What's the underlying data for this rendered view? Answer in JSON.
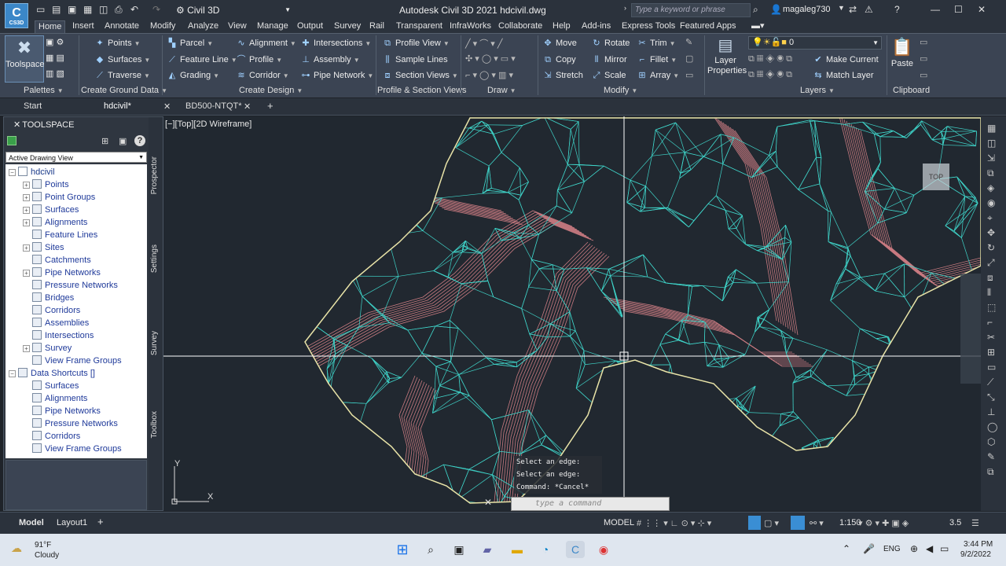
{
  "titlebar": {
    "logo": "C",
    "logo_sub": "CS3D",
    "workspace": "Civil 3D",
    "title": "Autodesk Civil 3D 2021   hdcivil.dwg",
    "search_placeholder": "Type a keyword or phrase",
    "user": "magaleg730"
  },
  "ribbon_tabs": [
    "Home",
    "Insert",
    "Annotate",
    "Modify",
    "Analyze",
    "View",
    "Manage",
    "Output",
    "Survey",
    "Rail",
    "Transparent",
    "InfraWorks",
    "Collaborate",
    "Help",
    "Add-ins",
    "Express Tools",
    "Featured Apps"
  ],
  "ribbon": {
    "toolspace": "Toolspace",
    "palettes": "Palettes",
    "ground": [
      "Points",
      "Surfaces",
      "Traverse"
    ],
    "ground_title": "Create Ground Data",
    "design_col1": [
      "Parcel",
      "Feature Line",
      "Grading"
    ],
    "design_col2": [
      "Alignment",
      "Profile",
      "Corridor"
    ],
    "design_col3": [
      "Intersections",
      "Assembly",
      "Pipe Network"
    ],
    "design_title": "Create Design",
    "profile": [
      "Profile View",
      "Sample Lines",
      "Section Views"
    ],
    "profile_title": "Profile & Section Views",
    "draw_title": "Draw",
    "modify_col1": [
      "Move",
      "Copy",
      "Stretch"
    ],
    "modify_col2": [
      "Rotate",
      "Mirror",
      "Scale"
    ],
    "modify_col3": [
      "Trim",
      "Fillet",
      "Array"
    ],
    "modify_title": "Modify",
    "layer_props": "Layer Properties",
    "layer_value": "0",
    "layer_actions": [
      "Make Current",
      "Match Layer"
    ],
    "layers_title": "Layers",
    "paste": "Paste",
    "clipboard_title": "Clipboard"
  },
  "doc_tabs": [
    "Start",
    "hdcivil*",
    "BD500-NTQT*"
  ],
  "toolspace": {
    "header": "TOOLSPACE",
    "view": "Active Drawing View",
    "side_tabs": [
      "Prospector",
      "Settings",
      "Survey",
      "Toolbox"
    ],
    "tree": [
      "hdcivil",
      "Points",
      "Point Groups",
      "Surfaces",
      "Alignments",
      "Feature Lines",
      "Sites",
      "Catchments",
      "Pipe Networks",
      "Pressure Networks",
      "Bridges",
      "Corridors",
      "Assemblies",
      "Intersections",
      "Survey",
      "View Frame Groups",
      "Data Shortcuts []",
      "Surfaces",
      "Alignments",
      "Pipe Networks",
      "Pressure Networks",
      "Corridors",
      "View Frame Groups"
    ]
  },
  "viewport": {
    "label": "[−][Top][2D Wireframe]",
    "cmd_history": [
      "Select an edge:",
      "Select an edge:",
      "Command: *Cancel*"
    ],
    "cmd_placeholder": "type a command",
    "viewcube": "TOP",
    "axis_x": "X",
    "axis_y": "Y"
  },
  "status": {
    "model_tab": "Model",
    "layout_tab": "Layout1",
    "model_btn": "MODEL",
    "scale": "1:150",
    "zoom": "3.5"
  },
  "taskbar": {
    "weather_temp": "91°F",
    "weather_desc": "Cloudy",
    "lang": "ENG",
    "time": "3:44 PM",
    "date": "9/2/2022"
  },
  "colors": {
    "mesh": "#3fd3c8",
    "contours": "#c87a80",
    "boundary": "#e9e4a8",
    "bg": "#212830"
  }
}
